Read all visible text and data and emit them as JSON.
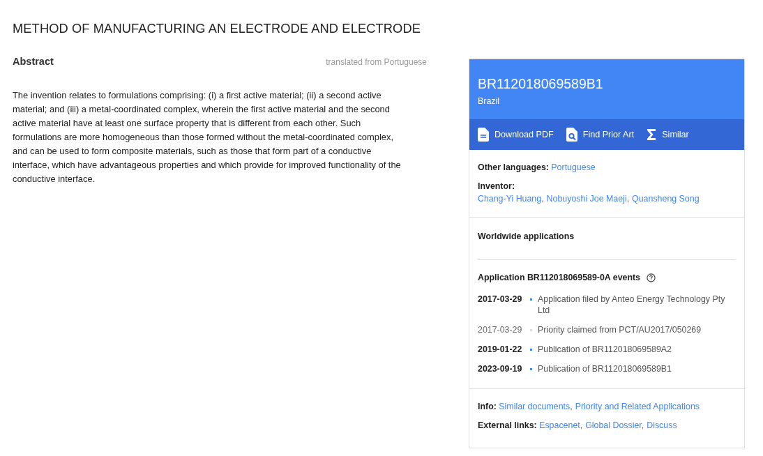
{
  "title": "METHOD OF MANUFACTURING AN ELECTRODE AND ELECTRODE",
  "abstract": {
    "heading": "Abstract",
    "note": "translated from Portuguese",
    "text": "The invention relates to formulations comprising: (i) a first active material; (ii) a second active material; and (iii) a metal-coordinated complex, wherein the first active material and the second active material have at least one surface property that is different from each other. Such formulations are more homogeneous than those formed without the metal-coordinated complex, and can be used to form composite materials, such as those that form part of a conductive interface, which have advantageous properties and which provide for improved functionality of the conductive interface."
  },
  "card": {
    "separator": ",",
    "number": "BR112018069589B1",
    "country": "Brazil",
    "actions": [
      {
        "kind": "pdf",
        "label": "Download PDF"
      },
      {
        "kind": "prior-art",
        "label": "Find Prior Art"
      },
      {
        "kind": "similar",
        "label": "Similar"
      }
    ],
    "other_languages": {
      "label": "Other languages:",
      "links": [
        "Portuguese"
      ]
    },
    "inventor": {
      "label": "Inventor:",
      "links": [
        "Chang-Yi Huang",
        "Nobuyoshi Joe Maeji",
        "Quansheng Song"
      ]
    },
    "worldwide": "Worldwide applications",
    "events_heading": "Application BR112018069589-0A events",
    "events": [
      {
        "date": "2017-03-29",
        "text": "Application filed by Anteo Energy Technology Pty Ltd",
        "primary": true
      },
      {
        "date": "2017-03-29",
        "text": "Priority claimed from PCT/AU2017/050269",
        "primary": false
      },
      {
        "date": "2019-01-22",
        "text": "Publication of BR112018069589A2",
        "primary": true
      },
      {
        "date": "2023-09-19",
        "text": "Publication of BR112018069589B1",
        "primary": true
      }
    ],
    "info": {
      "label": "Info:",
      "links": [
        "Similar documents",
        "Priority and Related Applications"
      ]
    },
    "external": {
      "label": "External links:",
      "links": [
        "Espacenet",
        "Global Dossier",
        "Discuss"
      ]
    }
  }
}
